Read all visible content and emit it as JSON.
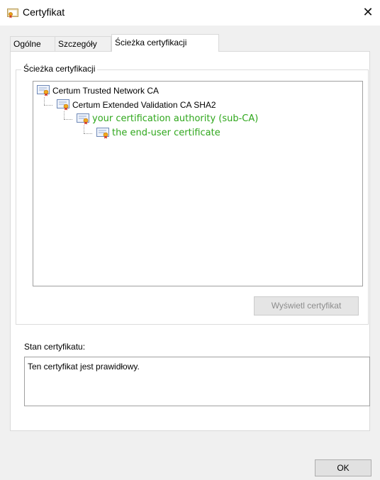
{
  "window": {
    "title": "Certyfikat",
    "close_glyph": "✕"
  },
  "tabs": [
    "Ogólne",
    "Szczegóły",
    "Ścieżka certyfikacji"
  ],
  "active_tab": 2,
  "path_group": {
    "legend": "Ścieżka certyfikacji",
    "items": [
      {
        "label": "Certum Trusted Network CA",
        "level": 0,
        "icon": "certificate-icon",
        "color": "#000000"
      },
      {
        "label": "Certum Extended Validation CA SHA2",
        "level": 1,
        "icon": "certificate-icon",
        "color": "#000000"
      },
      {
        "label": "your certification authority (sub-CA)",
        "level": 2,
        "icon": "certificate-icon",
        "color": "#2fa71c"
      },
      {
        "label": "the end-user certificate",
        "level": 3,
        "icon": "certificate-icon",
        "color": "#2fa71c"
      }
    ],
    "view_button": "Wyświetl certyfikat"
  },
  "status": {
    "label": "Stan certyfikatu:",
    "value": "Ten certyfikat jest prawidłowy."
  },
  "ok_button": "OK",
  "colors": {
    "accent_green": "#2fa71c",
    "dialog_bg": "#f0f0f0",
    "disabled_text": "#8d8d8d"
  }
}
